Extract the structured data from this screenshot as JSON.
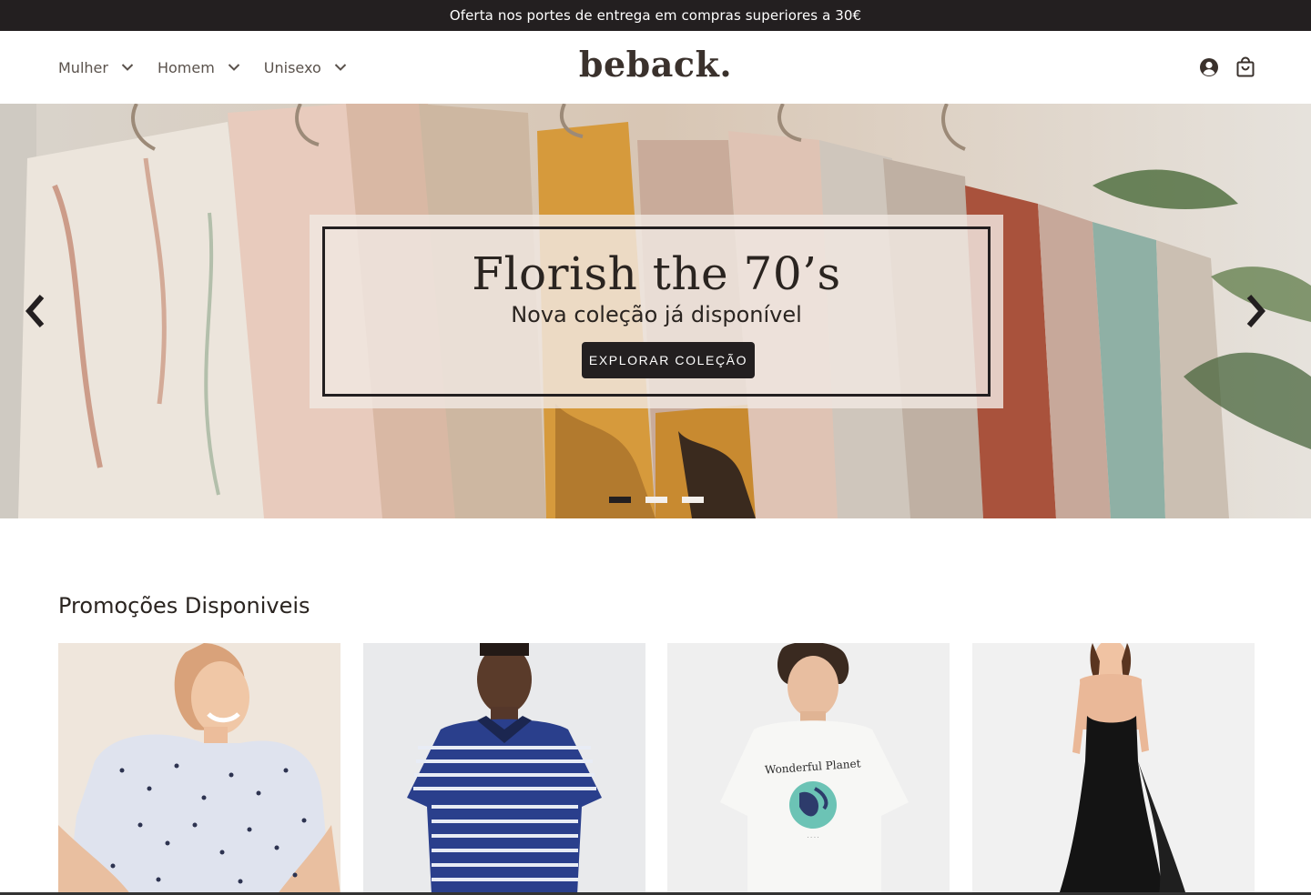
{
  "topbar": {
    "text": "Oferta nos portes de entrega em compras superiores a 30€"
  },
  "header": {
    "nav": [
      {
        "label": "Mulher",
        "icon": "chevron-down-icon"
      },
      {
        "label": "Homem",
        "icon": "chevron-down-icon"
      },
      {
        "label": "Unisexo",
        "icon": "chevron-down-icon"
      }
    ],
    "logo": "beback.",
    "icons": [
      "account-icon",
      "shopping-bag-icon"
    ]
  },
  "hero": {
    "title": "Florish the 70’s",
    "subtitle": "Nova coleção já disponível",
    "button_label": "EXPLORAR COLEÇÃO",
    "slides_total": 3,
    "active_slide": 1,
    "prev_icon": "chevron-left-icon",
    "next_icon": "chevron-right-icon"
  },
  "promotions": {
    "title": "Promoções Disponiveis",
    "products": [
      {
        "name": "woman-dotted-shirt"
      },
      {
        "name": "man-striped-polo"
      },
      {
        "name": "man-printed-tshirt",
        "print_text": "Wonderful Planet"
      },
      {
        "name": "woman-black-dress"
      }
    ]
  },
  "colors": {
    "dark": "#231f20",
    "text": "#2a2420",
    "nav_text": "#5a524c"
  }
}
